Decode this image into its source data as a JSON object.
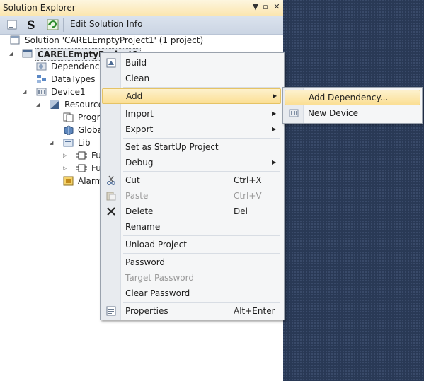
{
  "panel": {
    "title": "Solution Explorer",
    "title_buttons": [
      "dropdown-icon",
      "maximize-icon",
      "close-icon"
    ],
    "toolbar": {
      "edit_label": "Edit Solution Info"
    }
  },
  "tree": {
    "solution": "Solution 'CARELEmptyProject1' (1 project)",
    "project": "CARELEmptyProject1",
    "dependencies": "Dependencies",
    "datatypes": "DataTypes",
    "device": "Device1",
    "resource": "Resource1",
    "programs": "Programs",
    "globals": "Globals",
    "lib": "Lib",
    "fu1": "Fu",
    "fu2": "Fu",
    "alarms": "Alarms"
  },
  "context_menu": {
    "build": "Build",
    "clean": "Clean",
    "add": "Add",
    "import": "Import",
    "export": "Export",
    "startup": "Set as StartUp Project",
    "debug": "Debug",
    "cut": "Cut",
    "cut_sc": "Ctrl+X",
    "paste": "Paste",
    "paste_sc": "Ctrl+V",
    "delete": "Delete",
    "delete_sc": "Del",
    "rename": "Rename",
    "unload": "Unload Project",
    "password": "Password",
    "target_password": "Target Password",
    "clear_password": "Clear Password",
    "properties": "Properties",
    "properties_sc": "Alt+Enter"
  },
  "submenu": {
    "add_dependency": "Add Dependency...",
    "new_device": "New Device"
  },
  "colors": {
    "highlight": "#fbdf94",
    "background": "#293955"
  }
}
